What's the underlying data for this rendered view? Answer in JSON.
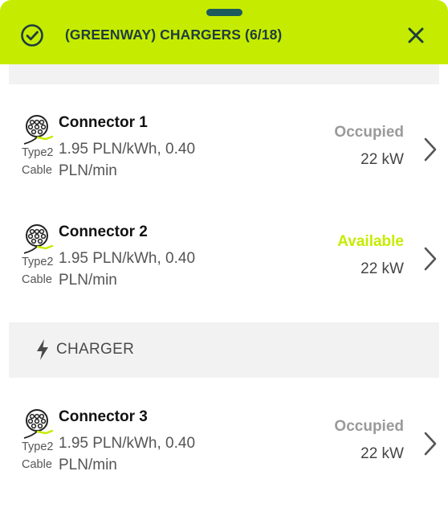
{
  "header": {
    "title": "(GREENWAY) CHARGERS (6/18)",
    "check_icon": "check-circle-icon",
    "close_icon": "close-icon",
    "accent_color": "#c5ec00"
  },
  "group": {
    "label": "CHARGER",
    "icon": "lightning-bolt-icon"
  },
  "connectors": [
    {
      "name": "Connector 1",
      "type": "Type2",
      "cable": "Cable",
      "price_line1": "1.95 PLN/kWh, 0.40",
      "price_line2": "PLN/min",
      "status": "Occupied",
      "status_color": "#9a9a9a",
      "power": "22 kW"
    },
    {
      "name": "Connector 2",
      "type": "Type2",
      "cable": "Cable",
      "price_line1": "1.95 PLN/kWh, 0.40",
      "price_line2": "PLN/min",
      "status": "Available",
      "status_color": "#c5ec00",
      "power": "22 kW"
    },
    {
      "name": "Connector 3",
      "type": "Type2",
      "cable": "Cable",
      "price_line1": "1.95 PLN/kWh, 0.40",
      "price_line2": "PLN/min",
      "status": "Occupied",
      "status_color": "#9a9a9a",
      "power": "22 kW"
    }
  ]
}
